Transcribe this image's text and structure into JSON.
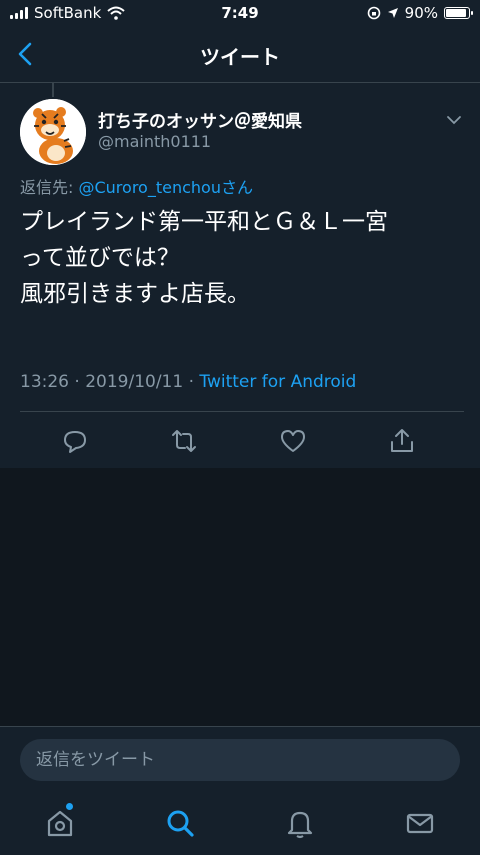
{
  "status_bar": {
    "carrier": "SoftBank",
    "time": "7:49",
    "battery": "90%",
    "battery_fraction": 0.9
  },
  "nav": {
    "title": "ツイート"
  },
  "tweet": {
    "name": "打ち子のオッサン＠愛知県",
    "handle": "@mainth0111",
    "reply_prefix": "返信先: ",
    "reply_mention": "@Curoro_tenchou",
    "reply_suffix": "さん",
    "lines": [
      "プレイランド第一平和とＧ＆Ｌ一宮",
      "って並びでは？",
      "風邪引きますよ店長。"
    ],
    "timestamp": "13:26 · 2019/10/11 · ",
    "source": "Twitter for Android"
  },
  "composer": {
    "placeholder": "返信をツイート"
  },
  "colors": {
    "accent": "#1da1f2",
    "muted": "#8899a6",
    "bar_bg": "#15202b",
    "page_bg": "#10171e"
  }
}
